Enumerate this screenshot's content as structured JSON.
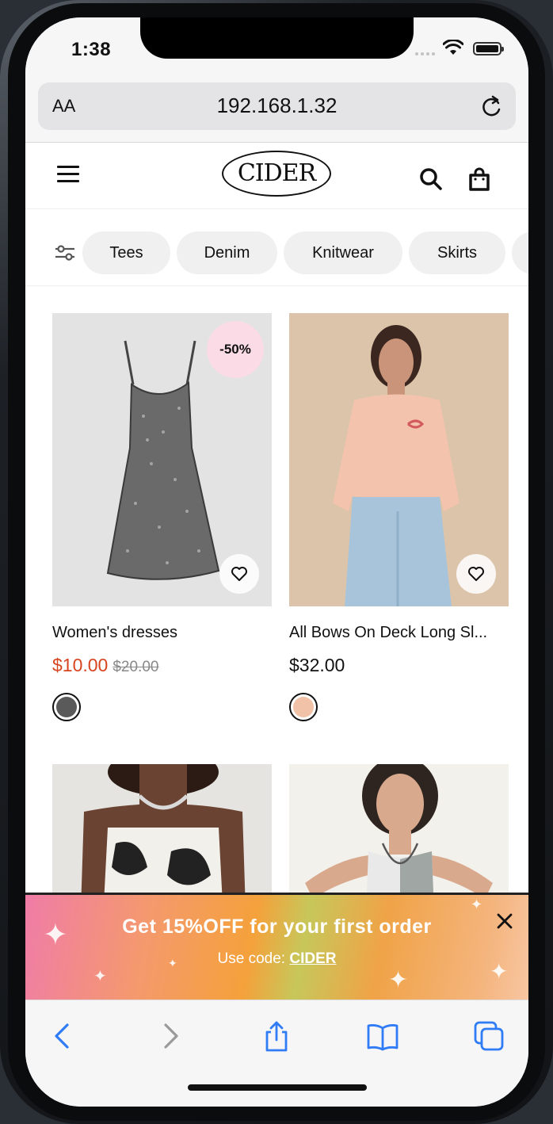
{
  "status_bar": {
    "time": "1:38"
  },
  "browser": {
    "text_size_label": "AA",
    "url": "192.168.1.32"
  },
  "site": {
    "logo": "CIDER"
  },
  "categories": [
    "Tees",
    "Denim",
    "Knitwear",
    "Skirts"
  ],
  "products": [
    {
      "title": "Women's dresses",
      "price": "$10.00",
      "original_price": "$20.00",
      "discount_badge": "-50%",
      "swatch_color": "#5a5a5a"
    },
    {
      "title": "All Bows On Deck Long Sl...",
      "price": "$32.00",
      "swatch_color": "#f2c2a8"
    }
  ],
  "promo": {
    "title": "Get 15%OFF for your first order",
    "code_label": "Use code:",
    "code": "CIDER"
  },
  "colors": {
    "sale_price": "#d6451f",
    "badge_bg": "#fbdbe6",
    "accent_blue": "#2f7cf6"
  }
}
